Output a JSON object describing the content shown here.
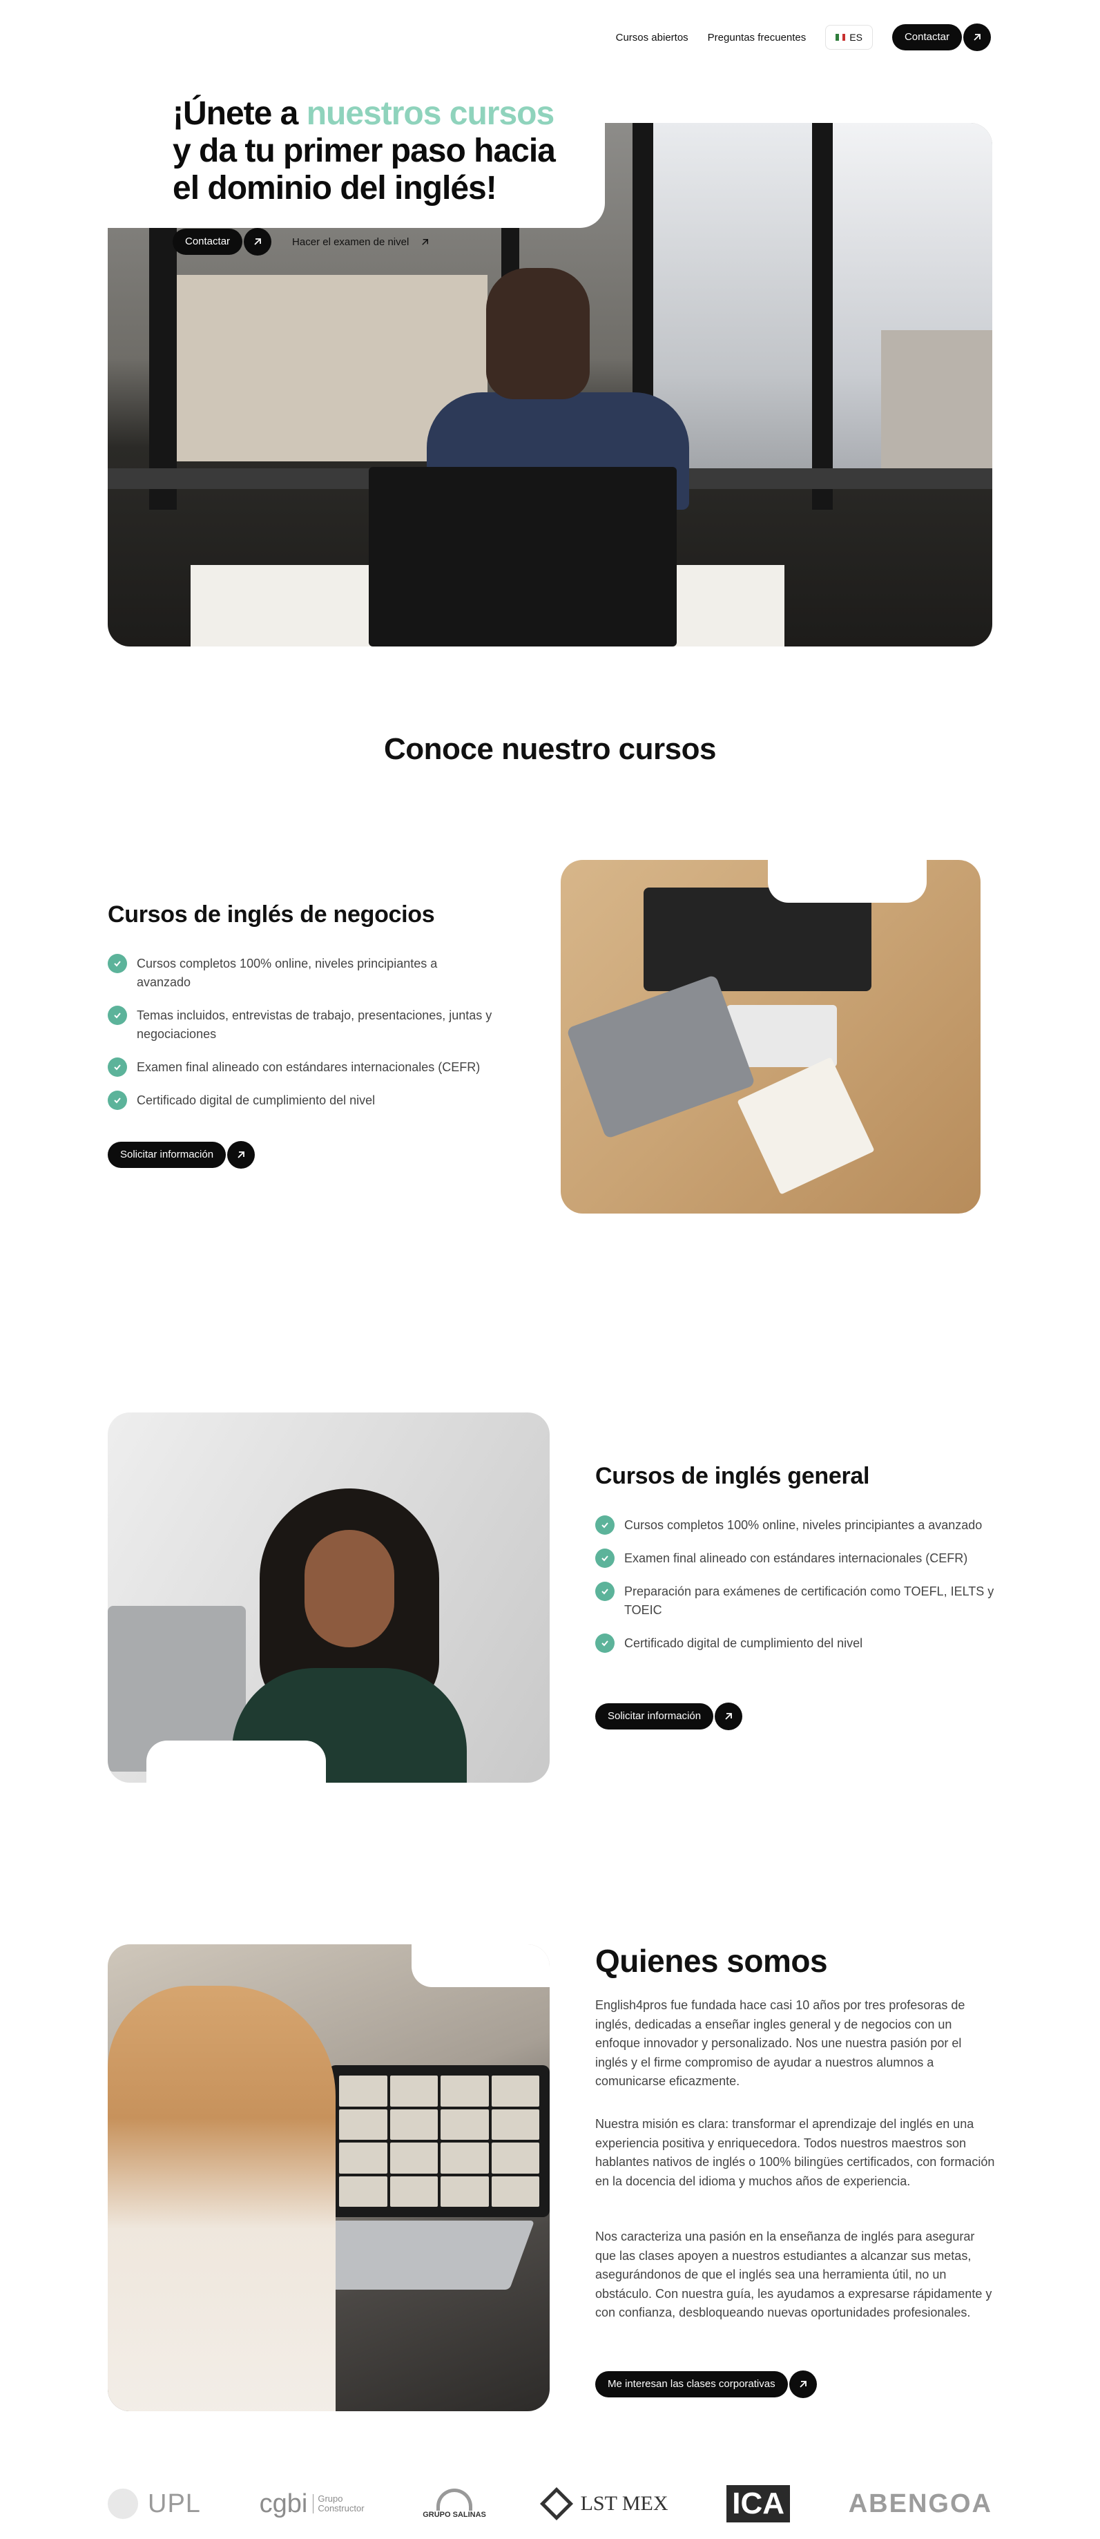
{
  "nav": {
    "items": [
      "Cursos abiertos",
      "Preguntas frecuentes"
    ],
    "language": "ES",
    "contact_label": "Contactar"
  },
  "hero": {
    "title_part1": "¡Únete a ",
    "title_accent": "nuestros cursos",
    "title_line2": "y da tu primer paso hacia",
    "title_line3": "el dominio del inglés!",
    "contact_label": "Contactar",
    "exam_label": "Hacer el examen de nivel"
  },
  "courses_section": {
    "title": "Conoce nuestro cursos"
  },
  "course_business": {
    "title": "Cursos de inglés de negocios",
    "features": [
      "Cursos completos 100% online, niveles principiantes a avanzado",
      "Temas incluidos, entrevistas de trabajo, presentaciones, juntas y negociaciones",
      "Examen final alineado con estándares internacionales (CEFR)",
      "Certificado digital de cumplimiento del nivel"
    ],
    "cta_label": "Solicitar información"
  },
  "course_general": {
    "title": "Cursos de inglés general",
    "features": [
      "Cursos completos 100% online, niveles principiantes a avanzado",
      "Examen final alineado con estándares internacionales (CEFR)",
      "Preparación para exámenes de certificación como TOEFL, IELTS y TOEIC",
      "Certificado digital de cumplimiento del nivel"
    ],
    "cta_label": "Solicitar información"
  },
  "about": {
    "title": "Quienes somos",
    "paragraphs": [
      "English4pros fue fundada hace casi 10 años por tres profesoras de inglés, dedicadas a enseñar ingles general y de negocios con un enfoque innovador y personalizado. Nos une nuestra pasión por el inglés y el firme compromiso de ayudar a nuestros alumnos a comunicarse eficazmente.",
      "Nuestra misión es clara: transformar el aprendizaje del inglés en una experiencia positiva y enriquecedora. Todos nuestros maestros son hablantes nativos de inglés o 100% bilingües certificados, con formación en la docencia del idioma y muchos años de experiencia.",
      "Nos caracteriza una pasión en la enseñanza de inglés para asegurar que las clases apoyen a nuestros estudiantes a alcanzar sus metas, asegurándonos de que el inglés sea una herramienta útil, no un obstáculo. Con nuestra guía, les ayudamos a expresarse rápidamente y con confianza, desbloqueando nuevas oportunidades profesionales."
    ],
    "cta_label": "Me interesan las clases corporativas"
  },
  "logos": {
    "upl": "UPL",
    "cgbi": "cgbi",
    "cgbi_sub1": "Grupo",
    "cgbi_sub2": "Constructor",
    "salinas": "GRUPO SALINAS",
    "lst": "LST MEX",
    "ica": "ICA",
    "abengoa": "ABENGOA"
  },
  "colors": {
    "accent": "#8fd3bc",
    "check": "#5cb39a",
    "button": "#0c0c0c"
  },
  "icons": {
    "arrow": "arrow-up-right-icon",
    "check": "check-icon",
    "flag": "mexico-flag-icon"
  }
}
